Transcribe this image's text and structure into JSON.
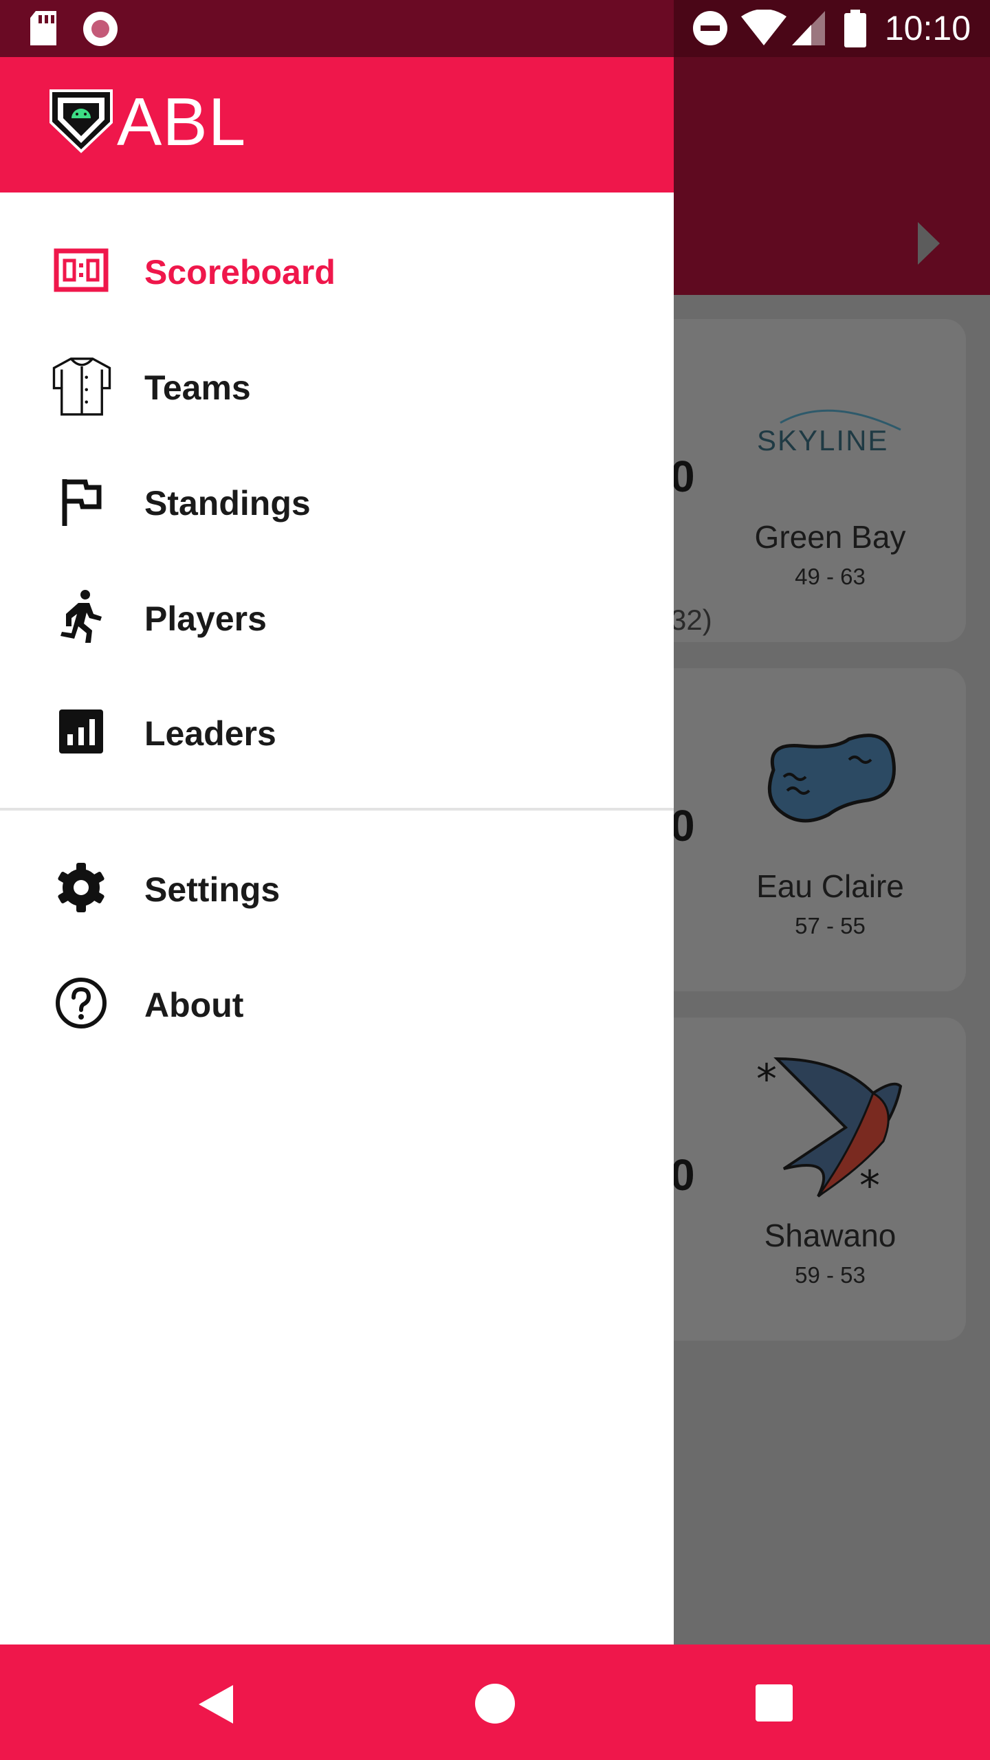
{
  "status_bar": {
    "time": "10:10",
    "icons": [
      "sd-card-icon",
      "record-icon",
      "do-not-disturb-icon",
      "wifi-icon",
      "cell-signal-icon",
      "battery-icon"
    ]
  },
  "drawer": {
    "title": "ABL",
    "logo": "android-home-plate-logo",
    "accent_color": "#ef174b",
    "items": [
      {
        "label": "Scoreboard",
        "icon": "scoreboard-icon",
        "active": true
      },
      {
        "label": "Teams",
        "icon": "jersey-icon"
      },
      {
        "label": "Standings",
        "icon": "flag-icon"
      },
      {
        "label": "Players",
        "icon": "runner-icon"
      },
      {
        "label": "Leaders",
        "icon": "bar-chart-icon"
      }
    ],
    "secondary_items": [
      {
        "label": "Settings",
        "icon": "gear-icon"
      },
      {
        "label": "About",
        "icon": "help-circle-icon"
      }
    ]
  },
  "background": {
    "games": [
      {
        "team": "Green Bay",
        "record": "49 - 63",
        "logo": "skyline-logo",
        "logo_text": "SKYLINE",
        "score": "0",
        "extra": "32)"
      },
      {
        "team": "Eau Claire",
        "record": "57 - 55",
        "logo": "peanut-logo",
        "score": "0"
      },
      {
        "team": "Shawano",
        "record": "59 - 53",
        "logo": "swallow-logo",
        "score": "0"
      }
    ]
  },
  "nav_bar": {
    "buttons": [
      "back-icon",
      "home-icon",
      "recents-icon"
    ]
  }
}
